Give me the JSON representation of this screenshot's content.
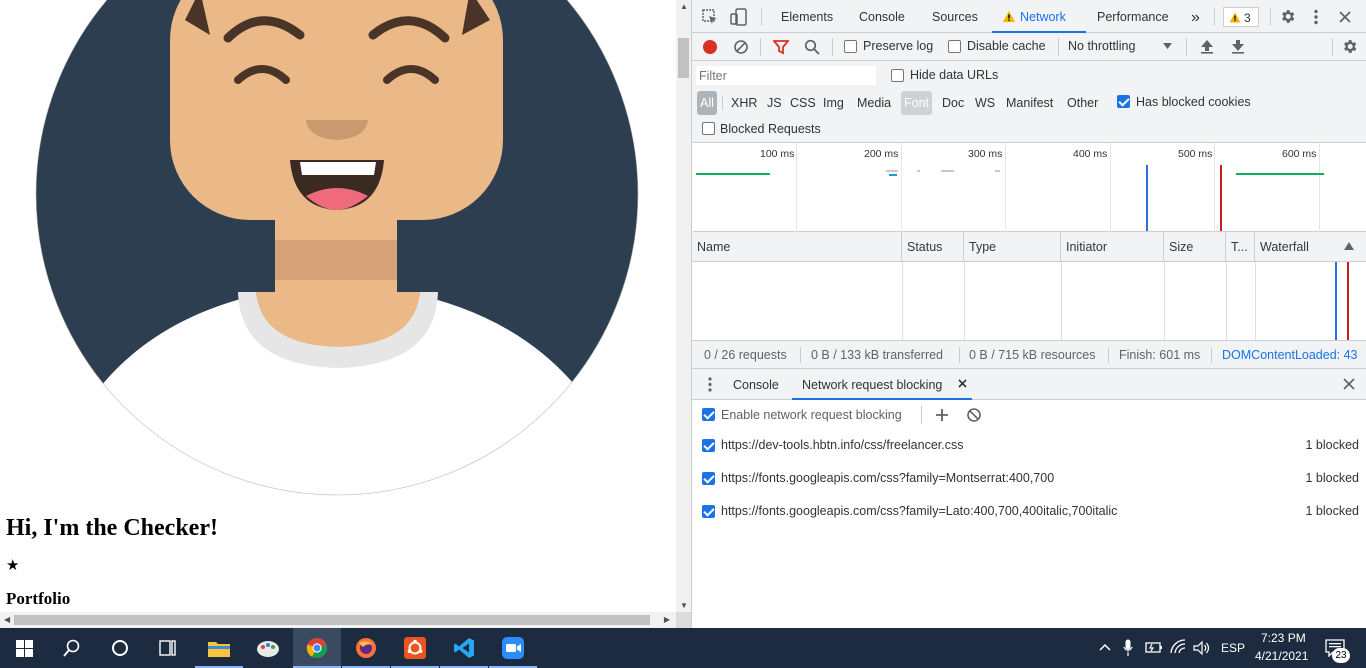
{
  "page": {
    "heading": "Hi, I'm the Checker!",
    "star": "★",
    "portfolio_heading": "Portfolio"
  },
  "devtools": {
    "tabs": [
      {
        "label": "Elements"
      },
      {
        "label": "Console"
      },
      {
        "label": "Sources"
      },
      {
        "label": "Network"
      },
      {
        "label": "Performance"
      }
    ],
    "more_tabs_glyph": "»",
    "warnings_count": "3",
    "toolbar": {
      "preserve_log": "Preserve log",
      "disable_cache": "Disable cache",
      "throttling": "No throttling"
    },
    "filter": {
      "placeholder": "Filter",
      "hide_data_urls": "Hide data URLs",
      "types": [
        "All",
        "XHR",
        "JS",
        "CSS",
        "Img",
        "Media",
        "Font",
        "Doc",
        "WS",
        "Manifest",
        "Other"
      ],
      "active_type": "All",
      "has_blocked_cookies": "Has blocked cookies",
      "blocked_requests": "Blocked Requests"
    },
    "overview": {
      "ticks": [
        "100 ms",
        "200 ms",
        "300 ms",
        "400 ms",
        "500 ms",
        "600 ms"
      ]
    },
    "table": {
      "columns": [
        "Name",
        "Status",
        "Type",
        "Initiator",
        "Size",
        "T...",
        "Waterfall"
      ]
    },
    "summary": {
      "requests": "0 / 26 requests",
      "transferred": "0 B / 133 kB transferred",
      "resources": "0 B / 715 kB resources",
      "finish": "Finish: 601 ms",
      "dom_content_loaded": "DOMContentLoaded: 43"
    },
    "drawer": {
      "tabs": [
        {
          "label": "Console"
        },
        {
          "label": "Network request blocking"
        }
      ],
      "enable_label": "Enable network request blocking",
      "patterns": [
        {
          "url": "https://dev-tools.hbtn.info/css/freelancer.css",
          "count": "1 blocked",
          "checked": true
        },
        {
          "url": "https://fonts.googleapis.com/css?family=Montserrat:400,700",
          "count": "1 blocked",
          "checked": true
        },
        {
          "url": "https://fonts.googleapis.com/css?family=Lato:400,700,400italic,700italic",
          "count": "1 blocked",
          "checked": true
        }
      ]
    }
  },
  "taskbar": {
    "apps": [
      "Start",
      "Search",
      "Cortana",
      "Task View",
      "File Explorer",
      "Paint",
      "Chrome",
      "Firefox",
      "Ubuntu",
      "VS Code",
      "Zoom"
    ],
    "active_app": "Chrome",
    "language": "ESP",
    "time": "7:23 PM",
    "date": "4/21/2021",
    "notifications": "23"
  },
  "colors": {
    "accent": "#1a73e8",
    "taskbar": "#1c2b3f",
    "avatar_bg": "#2c3e50",
    "skin": "#ebb887"
  }
}
